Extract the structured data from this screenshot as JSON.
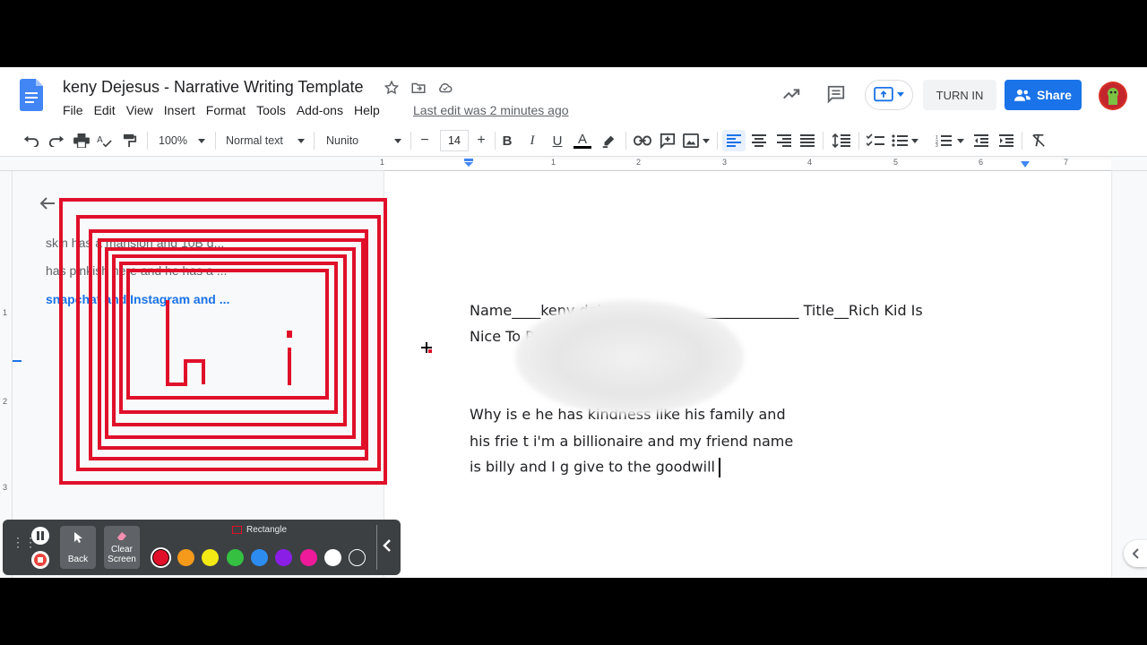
{
  "document": {
    "title": "keny Dejesus - Narrative Writing Template",
    "last_edit": "Last edit was 2 minutes ago"
  },
  "menu": [
    "File",
    "Edit",
    "View",
    "Insert",
    "Format",
    "Tools",
    "Add-ons",
    "Help"
  ],
  "actions": {
    "turn_in": "TURN IN",
    "share": "Share"
  },
  "toolbar": {
    "zoom": "100%",
    "style": "Normal text",
    "font": "Nunito",
    "font_size": "14"
  },
  "ruler_numbers": [
    "1",
    "1",
    "2",
    "3",
    "4",
    "5",
    "6",
    "7"
  ],
  "outline": {
    "items": [
      {
        "label": "skin has a mansion and 10B d...",
        "active": false
      },
      {
        "label": "has pinkish here and he has a ...",
        "active": false
      },
      {
        "label": "snapchat and Instagram and ...",
        "active": true
      }
    ]
  },
  "vertical_ruler": [
    "1",
    "2",
    "3"
  ],
  "body": {
    "line1": "Name____keny dejesus_______________________        Title__Rich Kid Is",
    "line2": "Nice To Poor",
    "para_line1": "Why is                                                  e he has kindness like his family and",
    "para_line2": "his frie                                            t i'm a billionaire and my friend name",
    "para_line3": "is billy and I g                              give to the goodwill"
  },
  "recorder": {
    "back": "Back",
    "clear": "Clear Screen",
    "shape_label": "Rectangle",
    "colors": [
      "#e0102a",
      "#f59a1b",
      "#f3e914",
      "#35c042",
      "#2d8cf0",
      "#8a1ee6",
      "#ee1a9a",
      "#ffffff",
      "transparent"
    ]
  },
  "annotation": {
    "stroke_color": "#e0102a",
    "drawn_text": "hi"
  }
}
